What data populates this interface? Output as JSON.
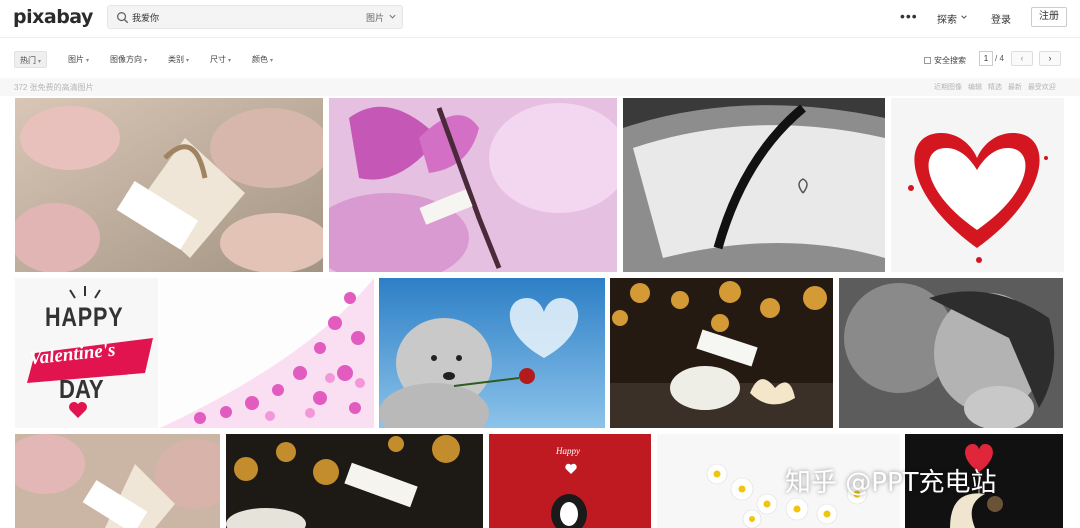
{
  "header": {
    "logo": "pixabay",
    "search_query": "我爱你",
    "search_type": "图片",
    "more": "•••",
    "explore": "探索",
    "login": "登录",
    "signup": "注册"
  },
  "filters": {
    "items": [
      "热门",
      "图片",
      "图像方向",
      "类别",
      "尺寸",
      "颜色"
    ],
    "safe_search": "安全搜索",
    "page_current": "1",
    "page_total": "/ 4",
    "prev": "‹",
    "next": "›"
  },
  "subbar": {
    "results": "372 张免费的高清图片",
    "sorts": [
      "近期图像",
      "编辑",
      "精选",
      "最新",
      "最受欢迎"
    ]
  },
  "images": [
    {
      "alt": "roses with i love you tag",
      "tag_text": "i love you"
    },
    {
      "alt": "pink magnolia with i love you tag",
      "tag_text": "i love you"
    },
    {
      "alt": "black and white notebook with heart"
    },
    {
      "alt": "red painted heart"
    },
    {
      "alt": "Happy Valentine's Day card",
      "lines": [
        "HAPPY",
        "Valentine's",
        "DAY"
      ]
    },
    {
      "alt": "pink hearts border"
    },
    {
      "alt": "dog with rose and heart cloud"
    },
    {
      "alt": "white roses with i love you tag and bokeh",
      "tag_text": "i love you"
    },
    {
      "alt": "couple black and white"
    },
    {
      "alt": "roses with i love you tag",
      "tag_text": "i love you"
    },
    {
      "alt": "bokeh with i love you tag",
      "tag_text": "I love you"
    },
    {
      "alt": "happy card with cat",
      "tag_text": "Happy"
    },
    {
      "alt": "daisies with pink hearts"
    },
    {
      "alt": "moon with heart balloon"
    }
  ],
  "watermark": "知乎 @PPT充电站"
}
